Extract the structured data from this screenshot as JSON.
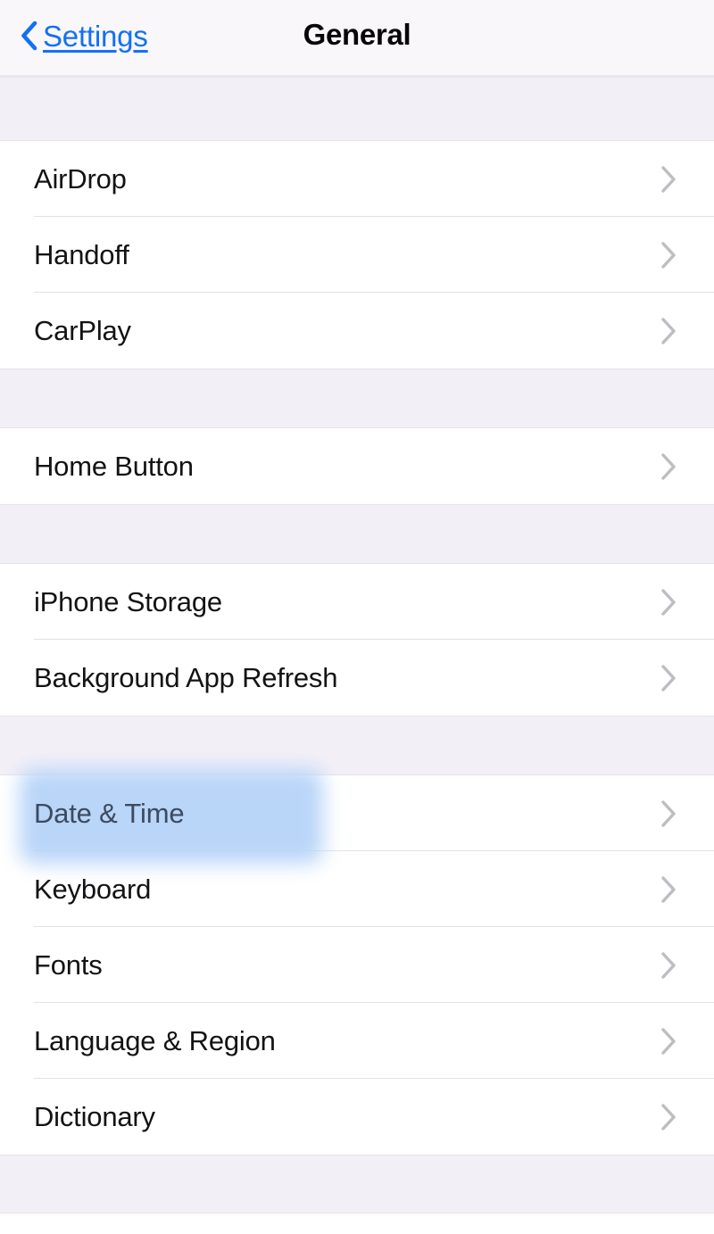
{
  "navbar": {
    "back_label": "Settings",
    "back_icon": "chevron-left-icon",
    "title": "General",
    "back_color": "#1271f2",
    "title_color": "#070708",
    "background": "#faf7fa"
  },
  "theme": {
    "row_background": "#ffffff",
    "section_gap_background": "#f2eff7",
    "separator_color": "#e2e2e5",
    "chevron_color": "#bdbdc2",
    "row_text_color": "#131315",
    "highlight_color": "#b6d3f8",
    "highlight_text_color": "#3c4b60"
  },
  "highlight": {
    "target_label": "Date & Time",
    "style": "blurred-blue-marker"
  },
  "sections": [
    {
      "id": "connectivity",
      "rows": [
        {
          "label": "AirDrop",
          "accessory": "chevron-right-icon"
        },
        {
          "label": "Handoff",
          "accessory": "chevron-right-icon"
        },
        {
          "label": "CarPlay",
          "accessory": "chevron-right-icon"
        }
      ]
    },
    {
      "id": "hardware",
      "rows": [
        {
          "label": "Home Button",
          "accessory": "chevron-right-icon"
        }
      ]
    },
    {
      "id": "storage",
      "rows": [
        {
          "label": "iPhone Storage",
          "accessory": "chevron-right-icon"
        },
        {
          "label": "Background App Refresh",
          "accessory": "chevron-right-icon"
        }
      ]
    },
    {
      "id": "localization",
      "rows": [
        {
          "label": "Date & Time",
          "accessory": "chevron-right-icon",
          "highlighted": true
        },
        {
          "label": "Keyboard",
          "accessory": "chevron-right-icon"
        },
        {
          "label": "Fonts",
          "accessory": "chevron-right-icon"
        },
        {
          "label": "Language & Region",
          "accessory": "chevron-right-icon"
        },
        {
          "label": "Dictionary",
          "accessory": "chevron-right-icon"
        }
      ]
    }
  ]
}
